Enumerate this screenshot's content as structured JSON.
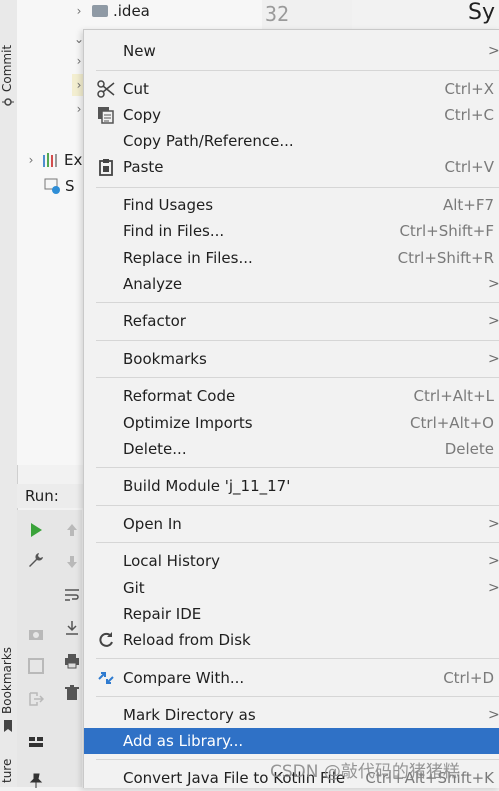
{
  "tree": {
    "rows": [
      {
        "label": ".idea"
      },
      {
        "label": "Ex"
      },
      {
        "label": "S"
      }
    ]
  },
  "editor": {
    "line_number": "32",
    "title_fragment": "Sy"
  },
  "left_strip": {
    "commit": "Commit",
    "bookmarks": "Bookmarks",
    "structure": "ture"
  },
  "run": {
    "label": "Run:"
  },
  "menu": {
    "new": "New",
    "cut": "Cut",
    "cut_sc": "Ctrl+X",
    "copy": "Copy",
    "copy_sc": "Ctrl+C",
    "copy_path": "Copy Path/Reference...",
    "paste": "Paste",
    "paste_sc": "Ctrl+V",
    "find_usages": "Find Usages",
    "find_usages_sc": "Alt+F7",
    "find_in_files": "Find in Files...",
    "find_in_files_sc": "Ctrl+Shift+F",
    "replace_in_files": "Replace in Files...",
    "replace_in_files_sc": "Ctrl+Shift+R",
    "analyze": "Analyze",
    "refactor": "Refactor",
    "bookmarks": "Bookmarks",
    "reformat": "Reformat Code",
    "reformat_sc": "Ctrl+Alt+L",
    "optimize": "Optimize Imports",
    "optimize_sc": "Ctrl+Alt+O",
    "delete": "Delete...",
    "delete_sc": "Delete",
    "build_module": "Build Module 'j_11_17'",
    "open_in": "Open In",
    "local_history": "Local History",
    "git": "Git",
    "repair_ide": "Repair IDE",
    "reload": "Reload from Disk",
    "compare": "Compare With...",
    "compare_sc": "Ctrl+D",
    "mark_dir": "Mark Directory as",
    "add_library": "Add as Library...",
    "convert": "Convert Java File to Kotlin File",
    "convert_sc": "Ctrl+Alt+Shift+K"
  },
  "watermark": "CSDN @敲代码的猪猪糕",
  "colors": {
    "selection": "#2f71c6",
    "run_green": "#3aa33a"
  }
}
